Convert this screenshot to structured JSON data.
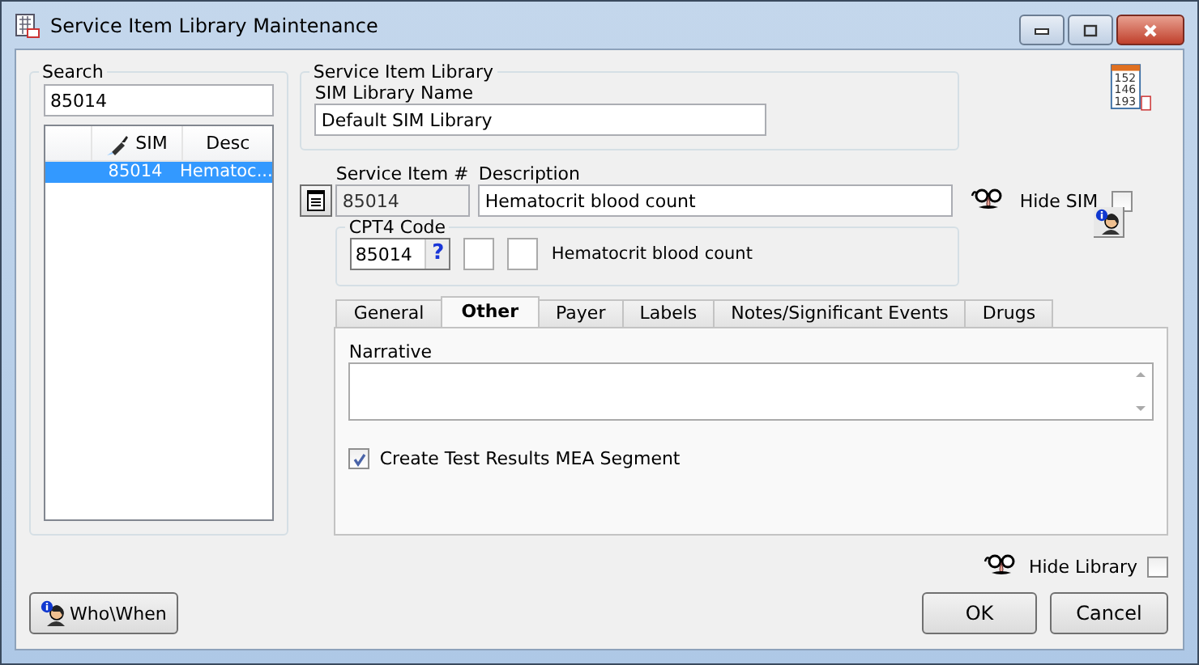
{
  "window": {
    "title": "Service Item Library Maintenance"
  },
  "search": {
    "label": "Search",
    "value": "85014",
    "columns": [
      "SIM",
      "Desc"
    ],
    "rows": [
      {
        "sim": "85014",
        "desc": "Hematoc...",
        "selected": true
      }
    ]
  },
  "library": {
    "group_label": "Service Item Library",
    "name_label": "SIM Library Name",
    "name_value": "Default SIM Library"
  },
  "report_icon_numbers": [
    "152",
    "146",
    "193"
  ],
  "item": {
    "number_label": "Service Item #",
    "number_value": "85014",
    "description_label": "Description",
    "description_value": "Hematocrit blood count",
    "hide_sim": {
      "label": "Hide SIM",
      "checked": false
    }
  },
  "cpt4": {
    "label": "CPT4 Code",
    "value": "85014",
    "help": "?",
    "description": "Hematocrit blood count"
  },
  "tabs": [
    {
      "label": "General",
      "selected": false
    },
    {
      "label": "Other",
      "selected": true
    },
    {
      "label": "Payer",
      "selected": false
    },
    {
      "label": "Labels",
      "selected": false
    },
    {
      "label": "Notes/Significant Events",
      "selected": false
    },
    {
      "label": "Drugs",
      "selected": false
    }
  ],
  "other_tab": {
    "narrative_label": "Narrative",
    "create_mea": {
      "label": "Create Test Results MEA Segment",
      "checked": true
    }
  },
  "hide_library": {
    "label": "Hide Library",
    "checked": false
  },
  "buttons": {
    "who_when": "Who\\When",
    "ok": "OK",
    "cancel": "Cancel"
  }
}
